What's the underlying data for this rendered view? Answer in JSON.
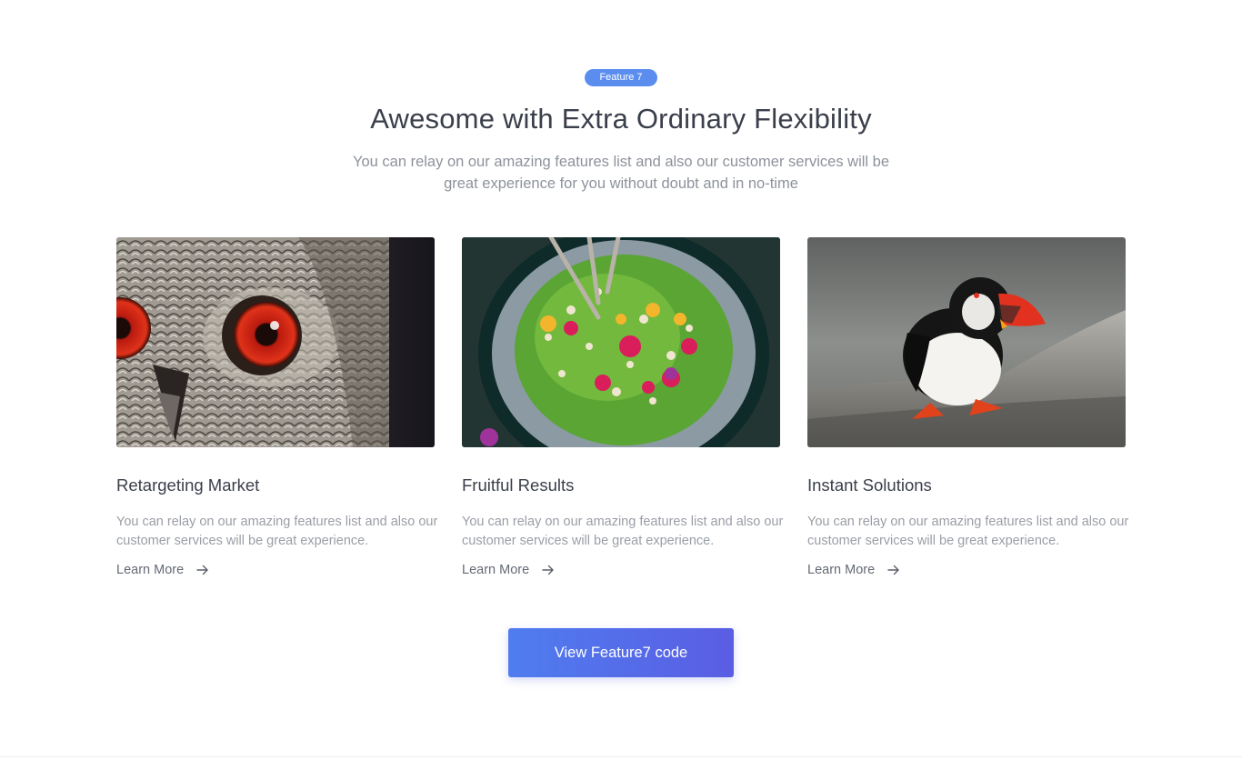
{
  "section": {
    "badge": "Feature 7",
    "title": "Awesome with Extra Ordinary Flexibility",
    "subtitle": "You can relay on our amazing features list and also our customer services will be great experience for you without doubt and in no-time"
  },
  "cards": [
    {
      "image": "owl-photo",
      "title": "Retargeting Market",
      "text": "You can relay on our amazing features list and also our customer services will be great experience.",
      "link": "Learn More"
    },
    {
      "image": "salad-bowl-photo",
      "title": "Fruitful Results",
      "text": "You can relay on our amazing features list and also our customer services will be great experience.",
      "link": "Learn More"
    },
    {
      "image": "puffin-photo",
      "title": "Instant Solutions",
      "text": "You can relay on our amazing features list and also our customer services will be great experience.",
      "link": "Learn More"
    }
  ],
  "cta": {
    "label": "View Feature7 code"
  },
  "icons": {
    "link_arrow": "arrow-right-icon"
  },
  "colors": {
    "badge": "#5b8def",
    "cta_start": "#4f7def",
    "cta_end": "#5a5de3",
    "title": "#3a3f4b",
    "muted_text": "#9a9ea6"
  }
}
